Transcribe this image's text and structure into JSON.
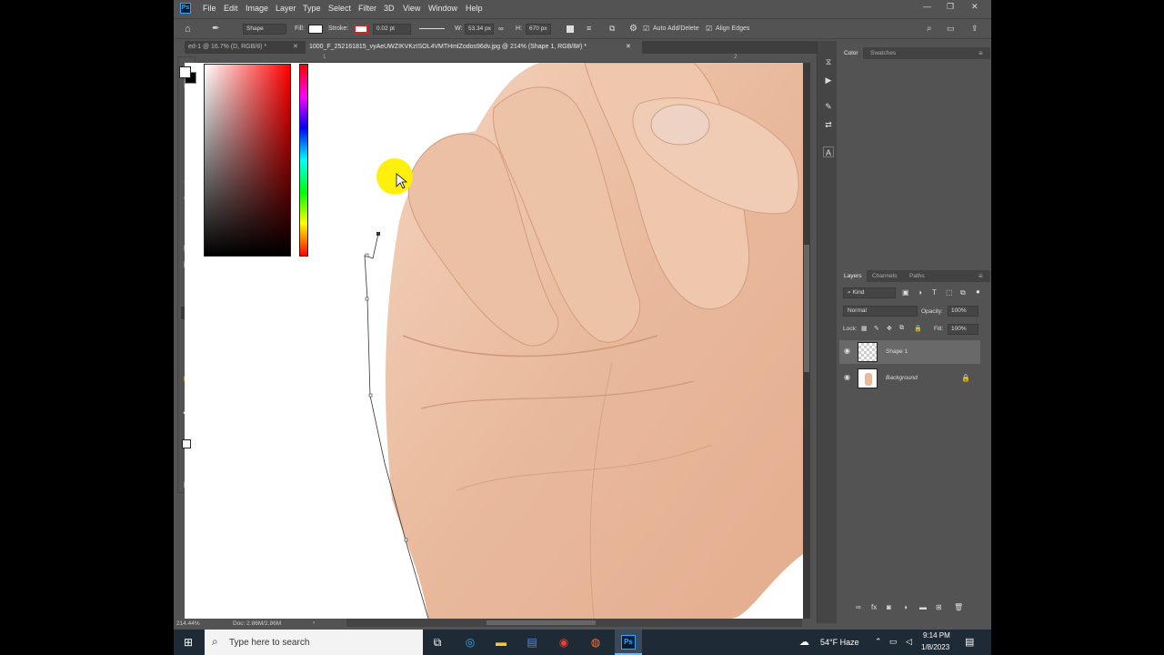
{
  "menu": {
    "items": [
      "File",
      "Edit",
      "Image",
      "Layer",
      "Type",
      "Select",
      "Filter",
      "3D",
      "View",
      "Window",
      "Help"
    ]
  },
  "options": {
    "mode": "Shape",
    "fill_label": "Fill:",
    "stroke_label": "Stroke:",
    "stroke_width": "0.02 pt",
    "w_label": "W:",
    "w_value": "53.34 px",
    "h_label": "H:",
    "h_value": "670 px",
    "auto_add_delete": "Auto Add/Delete",
    "align_edges": "Align Edges"
  },
  "tabs": {
    "tab1": "ed-1 @ 16.7% (D, RGB/8) *",
    "tab2": "1000_F_252161815_vyAeUWZIKVKzISOL4VMTHmlZodos96dv.jpg @ 214% (Shape 1, RGB/8#) *"
  },
  "rulers": {
    "h1": "1",
    "h2": "2"
  },
  "status": {
    "zoom": "214.44%",
    "doc": "Doc: 2.86M/2.86M"
  },
  "color_panel": {
    "tabs": [
      "Color",
      "Swatches"
    ]
  },
  "layers_panel": {
    "tabs": [
      "Layers",
      "Channels",
      "Paths"
    ],
    "kind": "Kind",
    "blend_mode": "Normal",
    "opacity_label": "Opacity:",
    "opacity": "100%",
    "lock_label": "Lock:",
    "fill_label": "Fill:",
    "fill": "100%",
    "layers": [
      {
        "name": "Shape 1"
      },
      {
        "name": "Background"
      }
    ]
  },
  "taskbar": {
    "search_placeholder": "Type here to search",
    "weather": "54°F  Haze",
    "time": "9:14 PM",
    "date": "1/8/2023"
  },
  "colors": {
    "ps_bg": "#535353",
    "accent": "#31a8ff",
    "cursor_highlight": "#ffee00"
  }
}
